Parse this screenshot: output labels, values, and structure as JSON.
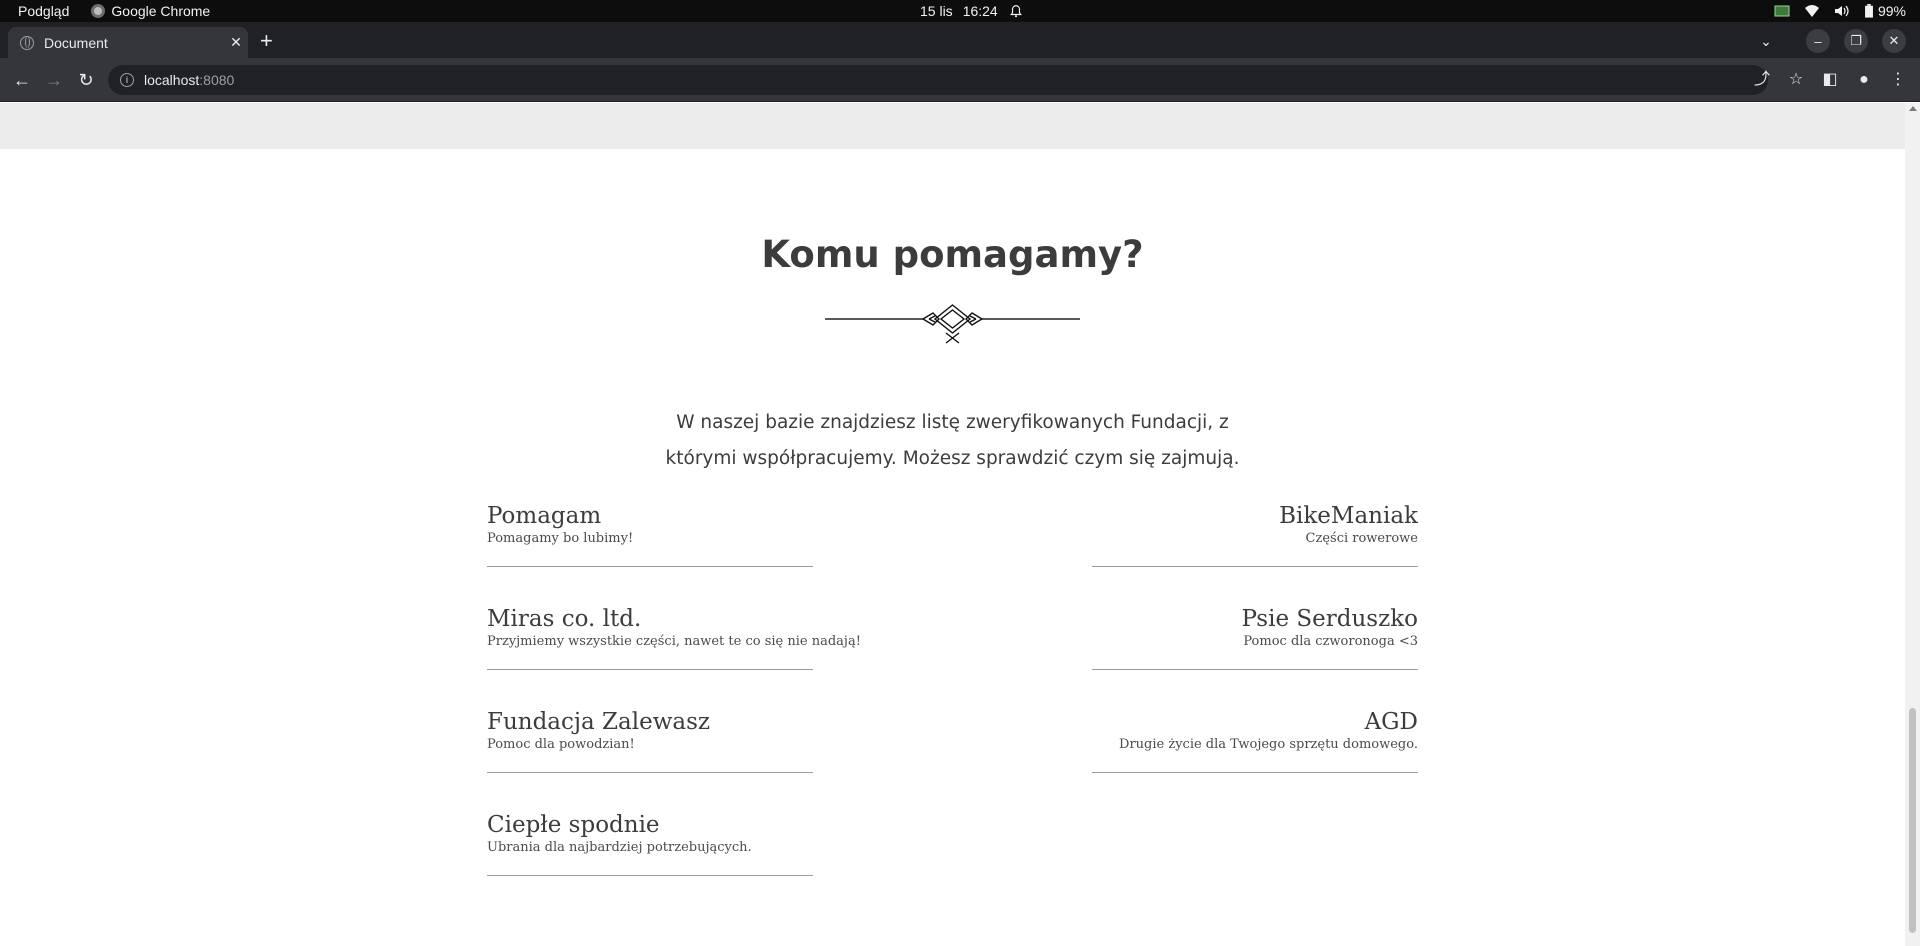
{
  "os_bar": {
    "app_menu": "Podgląd",
    "active_app": "Google Chrome",
    "date": "15 lis",
    "time": "16:24",
    "battery": "99%"
  },
  "browser": {
    "tab_title": "Document",
    "url_host": "localhost",
    "url_port": ":8080"
  },
  "page": {
    "heading": "Komu pomagamy?",
    "intro": "W naszej bazie znajdziesz listę zweryfikowanych Fundacji, z którymi współpracujemy. Możesz sprawdzić czym się zajmują.",
    "organizations": [
      {
        "name": "Pomagam",
        "description": "Pomagamy bo lubimy!"
      },
      {
        "name": "BikeManiak",
        "description": "Części rowerowe"
      },
      {
        "name": "Miras co. ltd.",
        "description": "Przyjmiemy wszystkie części, nawet te co się nie nadają!"
      },
      {
        "name": "Psie Serduszko",
        "description": "Pomoc dla czworonoga <3"
      },
      {
        "name": "Fundacja Zalewasz",
        "description": "Pomoc dla powodzian!"
      },
      {
        "name": "AGD",
        "description": "Drugie życie dla Twojego sprzętu domowego."
      },
      {
        "name": "Ciepłe spodnie",
        "description": "Ubrania dla najbardziej potrzebujących."
      }
    ]
  },
  "icons": {
    "tray": [
      "screenshot-icon",
      "wifi-icon",
      "volume-icon",
      "battery-icon"
    ],
    "toolbar": [
      "share-icon",
      "star-icon",
      "side-panel-icon",
      "profile-icon",
      "menu-icon"
    ]
  }
}
